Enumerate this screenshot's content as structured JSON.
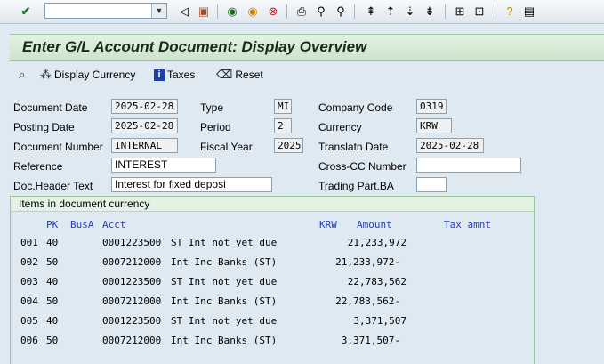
{
  "title": "Enter G/L Account Document: Display Overview",
  "app_toolbar": {
    "display_currency": "Display Currency",
    "taxes": "Taxes",
    "reset": "Reset"
  },
  "header": {
    "document_date": {
      "label": "Document Date",
      "value": "2025-02-28"
    },
    "posting_date": {
      "label": "Posting Date",
      "value": "2025-02-28"
    },
    "document_number": {
      "label": "Document Number",
      "value": "INTERNAL"
    },
    "reference": {
      "label": "Reference",
      "value": "INTEREST"
    },
    "doc_header_text": {
      "label": "Doc.Header Text",
      "value": "Interest for fixed deposi"
    },
    "type": {
      "label": "Type",
      "value": "MI"
    },
    "period": {
      "label": "Period",
      "value": "2"
    },
    "fiscal_year": {
      "label": "Fiscal Year",
      "value": "2025"
    },
    "company_code": {
      "label": "Company Code",
      "value": "0319"
    },
    "currency": {
      "label": "Currency",
      "value": "KRW"
    },
    "translation_date": {
      "label": "Translatn Date",
      "value": "2025-02-28"
    },
    "cross_cc_number": {
      "label": "Cross-CC Number",
      "value": ""
    },
    "trading_part_ba": {
      "label": "Trading Part.BA",
      "value": ""
    }
  },
  "items": {
    "section_title": "Items in document currency",
    "columns": {
      "pk": "PK",
      "busa": "BusA",
      "acct": "Acct",
      "krw": "KRW",
      "amount": "Amount",
      "tax": "Tax amnt"
    },
    "rows": [
      {
        "line": "001",
        "pk": "40",
        "acct": "0001223500",
        "text": "ST Int not yet due",
        "amount": "21,233,972"
      },
      {
        "line": "002",
        "pk": "50",
        "acct": "0007212000",
        "text": "Int Inc Banks (ST)",
        "amount": "21,233,972-"
      },
      {
        "line": "003",
        "pk": "40",
        "acct": "0001223500",
        "text": "ST Int not yet due",
        "amount": "22,783,562"
      },
      {
        "line": "004",
        "pk": "50",
        "acct": "0007212000",
        "text": "Int Inc Banks (ST)",
        "amount": "22,783,562-"
      },
      {
        "line": "005",
        "pk": "40",
        "acct": "0001223500",
        "text": "ST Int not yet due",
        "amount": "3,371,507"
      },
      {
        "line": "006",
        "pk": "50",
        "acct": "0007212000",
        "text": "Int Inc Banks (ST)",
        "amount": "3,371,507-"
      }
    ]
  }
}
